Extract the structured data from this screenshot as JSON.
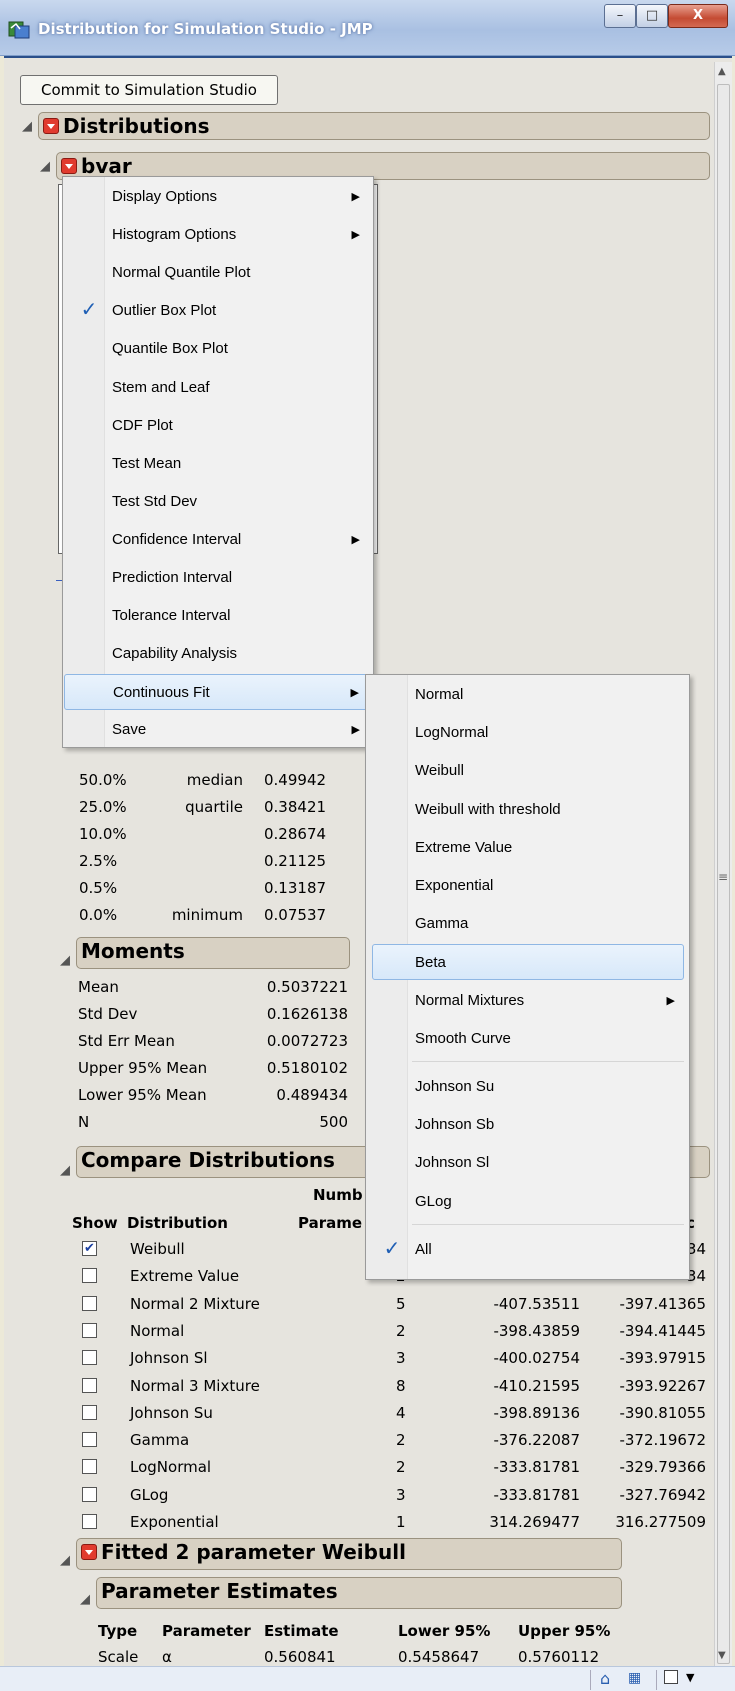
{
  "window": {
    "title": "Distribution for Simulation Studio - JMP",
    "min_label": "–",
    "max_label": "□",
    "close_label": "X"
  },
  "report": {
    "commit_button": "Commit to Simulation Studio",
    "distributions_title": "Distributions",
    "bvar_title": "bvar",
    "quantiles": [
      {
        "pct": "50.0%",
        "label": "median",
        "value": "0.49942"
      },
      {
        "pct": "25.0%",
        "label": "quartile",
        "value": "0.38421"
      },
      {
        "pct": "10.0%",
        "label": "",
        "value": "0.28674"
      },
      {
        "pct": "2.5%",
        "label": "",
        "value": "0.21125"
      },
      {
        "pct": "0.5%",
        "label": "",
        "value": "0.13187"
      },
      {
        "pct": "0.0%",
        "label": "minimum",
        "value": "0.07537"
      }
    ],
    "moments_title": "Moments",
    "moments": [
      {
        "label": "Mean",
        "value": "0.5037221"
      },
      {
        "label": "Std Dev",
        "value": "0.1626138"
      },
      {
        "label": "Std Err Mean",
        "value": "0.0072723"
      },
      {
        "label": "Upper 95% Mean",
        "value": "0.5180102"
      },
      {
        "label": "Lower 95% Mean",
        "value": "0.489434"
      },
      {
        "label": "N",
        "value": "500"
      }
    ],
    "compare_title": "Compare Distributions",
    "compare_headers": {
      "show": "Show",
      "distribution": "Distribution",
      "numb": "Numb",
      "parame": "Parame",
      "c": "c"
    },
    "compare_rows": [
      {
        "name": "Weibull",
        "checked": true,
        "n": "",
        "aicc": "",
        "bic": "34"
      },
      {
        "name": "Extreme Value",
        "checked": false,
        "n": "2",
        "aicc": "",
        "bic": "34"
      },
      {
        "name": "Normal 2 Mixture",
        "checked": false,
        "n": "5",
        "aicc": "-407.53511",
        "bic": "-397.41365"
      },
      {
        "name": "Normal",
        "checked": false,
        "n": "2",
        "aicc": "-398.43859",
        "bic": "-394.41445"
      },
      {
        "name": "Johnson Sl",
        "checked": false,
        "n": "3",
        "aicc": "-400.02754",
        "bic": "-393.97915"
      },
      {
        "name": "Normal 3 Mixture",
        "checked": false,
        "n": "8",
        "aicc": "-410.21595",
        "bic": "-393.92267"
      },
      {
        "name": "Johnson Su",
        "checked": false,
        "n": "4",
        "aicc": "-398.89136",
        "bic": "-390.81055"
      },
      {
        "name": "Gamma",
        "checked": false,
        "n": "2",
        "aicc": "-376.22087",
        "bic": "-372.19672"
      },
      {
        "name": "LogNormal",
        "checked": false,
        "n": "2",
        "aicc": "-333.81781",
        "bic": "-329.79366"
      },
      {
        "name": "GLog",
        "checked": false,
        "n": "3",
        "aicc": "-333.81781",
        "bic": "-327.76942"
      },
      {
        "name": "Exponential",
        "checked": false,
        "n": "1",
        "aicc": "314.269477",
        "bic": "316.277509"
      }
    ],
    "fitted_title": "Fitted 2 parameter Weibull",
    "param_title": "Parameter Estimates",
    "param_headers": [
      "Type",
      "Parameter",
      "Estimate",
      "Lower 95%",
      "Upper 95%"
    ],
    "param_row": [
      "Scale",
      "α",
      "0.560841",
      "0.5458647",
      "0.5760112"
    ]
  },
  "menu": {
    "items": [
      {
        "label": "Display Options",
        "submenu": true,
        "checked": false
      },
      {
        "label": "Histogram Options",
        "submenu": true,
        "checked": false
      },
      {
        "label": "Normal Quantile Plot",
        "submenu": false,
        "checked": false
      },
      {
        "label": "Outlier Box Plot",
        "submenu": false,
        "checked": true
      },
      {
        "label": "Quantile Box Plot",
        "submenu": false,
        "checked": false
      },
      {
        "label": "Stem and Leaf",
        "submenu": false,
        "checked": false
      },
      {
        "label": "CDF Plot",
        "submenu": false,
        "checked": false
      },
      {
        "label": "Test Mean",
        "submenu": false,
        "checked": false
      },
      {
        "label": "Test Std Dev",
        "submenu": false,
        "checked": false
      },
      {
        "label": "Confidence Interval",
        "submenu": true,
        "checked": false
      },
      {
        "label": "Prediction Interval",
        "submenu": false,
        "checked": false
      },
      {
        "label": "Tolerance Interval",
        "submenu": false,
        "checked": false
      },
      {
        "label": "Capability Analysis",
        "submenu": false,
        "checked": false
      },
      {
        "label": "Continuous Fit",
        "submenu": true,
        "checked": false,
        "highlighted": true
      },
      {
        "label": "Save",
        "submenu": true,
        "checked": false
      }
    ]
  },
  "submenu": {
    "items": [
      {
        "label": "Normal"
      },
      {
        "label": "LogNormal"
      },
      {
        "label": "Weibull"
      },
      {
        "label": "Weibull with threshold"
      },
      {
        "label": "Extreme Value"
      },
      {
        "label": "Exponential"
      },
      {
        "label": "Gamma"
      },
      {
        "label": "Beta",
        "highlighted": true
      },
      {
        "label": "Normal Mixtures",
        "submenu": true
      },
      {
        "label": "Smooth Curve"
      },
      {
        "label": "Johnson Su"
      },
      {
        "label": "Johnson Sb"
      },
      {
        "label": "Johnson Sl"
      },
      {
        "label": "GLog"
      },
      {
        "label": "All",
        "checked": true
      }
    ]
  }
}
